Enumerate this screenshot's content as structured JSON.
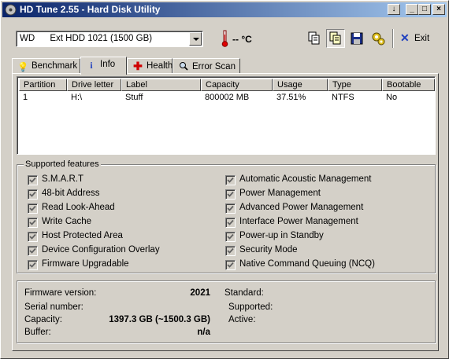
{
  "window": {
    "title": "HD Tune 2.55 - Hard Disk Utility",
    "controls": {
      "extra": "↓",
      "minimize": "_",
      "maximize": "□",
      "close": "×"
    }
  },
  "toolbar": {
    "drive_select": "WD      Ext HDD 1021 (1500 GB)",
    "temperature": "-- °C",
    "exit_label": "Exit",
    "icons": [
      "copy-icon",
      "copy-screen-icon",
      "save-icon",
      "options-icon",
      "exit-icon"
    ]
  },
  "tabs": [
    {
      "label": "Benchmark",
      "icon": "lightbulb-icon"
    },
    {
      "label": "Info",
      "icon": "info-icon",
      "active": true
    },
    {
      "label": "Health",
      "icon": "health-cross-icon"
    },
    {
      "label": "Error Scan",
      "icon": "magnifier-icon"
    }
  ],
  "partitions": {
    "columns": [
      "Partition",
      "Drive letter",
      "Label",
      "Capacity",
      "Usage",
      "Type",
      "Bootable"
    ],
    "rows": [
      [
        "1",
        "H:\\",
        "Stuff",
        "800002 MB",
        "37.51%",
        "NTFS",
        "No"
      ]
    ]
  },
  "features": {
    "caption": "Supported features",
    "left": [
      {
        "label": "S.M.A.R.T",
        "checked": true
      },
      {
        "label": "48-bit Address",
        "checked": true
      },
      {
        "label": "Read Look-Ahead",
        "checked": true
      },
      {
        "label": "Write Cache",
        "checked": true
      },
      {
        "label": "Host Protected Area",
        "checked": true
      },
      {
        "label": "Device Configuration Overlay",
        "checked": true
      },
      {
        "label": "Firmware Upgradable",
        "checked": true
      }
    ],
    "right": [
      {
        "label": "Automatic Acoustic Management",
        "checked": true
      },
      {
        "label": "Power Management",
        "checked": true
      },
      {
        "label": "Advanced Power Management",
        "checked": true
      },
      {
        "label": "Interface Power Management",
        "checked": true
      },
      {
        "label": "Power-up in Standby",
        "checked": true
      },
      {
        "label": "Security Mode",
        "checked": true
      },
      {
        "label": "Native Command Queuing (NCQ)",
        "checked": true
      }
    ]
  },
  "details": {
    "firmware_label": "Firmware version:",
    "firmware_value": "2021",
    "serial_label": "Serial number:",
    "serial_value": "",
    "capacity_label": "Capacity:",
    "capacity_value": "1397.3 GB (~1500.3 GB)",
    "buffer_label": "Buffer:",
    "buffer_value": "n/a",
    "standard_label": "Standard:",
    "standard_value": "",
    "supported_label": "Supported:",
    "supported_value": "",
    "active_label": "Active:",
    "active_value": ""
  },
  "colors": {
    "title_gradient_start": "#0a246a",
    "title_gradient_end": "#a6caf0",
    "face": "#d4d0c8"
  }
}
